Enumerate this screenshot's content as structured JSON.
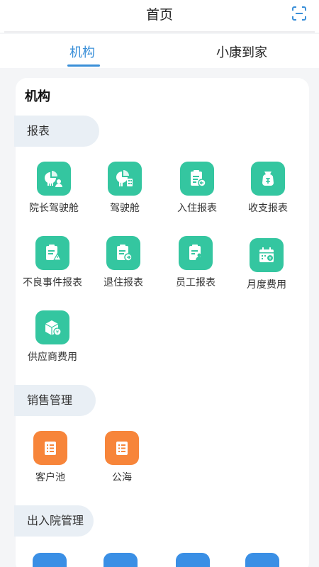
{
  "header": {
    "title": "首页",
    "scan_icon": "scan-icon"
  },
  "tabs": [
    {
      "label": "机构",
      "active": true
    },
    {
      "label": "小康到家",
      "active": false
    }
  ],
  "card": {
    "title": "机构"
  },
  "sections": [
    {
      "label": "报表",
      "items": [
        {
          "label": "院长驾驶舱",
          "icon": "dashboard-user-icon"
        },
        {
          "label": "驾驶舱",
          "icon": "dashboard-icon"
        },
        {
          "label": "入住报表",
          "icon": "check-in-report-icon"
        },
        {
          "label": "收支报表",
          "icon": "money-bag-icon"
        },
        {
          "label": "不良事件报表",
          "icon": "incident-report-icon"
        },
        {
          "label": "退住报表",
          "icon": "check-out-report-icon"
        },
        {
          "label": "员工报表",
          "icon": "staff-report-icon"
        },
        {
          "label": "月度费用",
          "icon": "monthly-fee-icon"
        },
        {
          "label": "供应商费用",
          "icon": "supplier-fee-icon"
        }
      ]
    },
    {
      "label": "销售管理",
      "items": [
        {
          "label": "客户池",
          "icon": "customer-pool-icon"
        },
        {
          "label": "公海",
          "icon": "public-pool-icon"
        }
      ]
    },
    {
      "label": "出入院管理",
      "items": []
    }
  ],
  "colors": {
    "accent": "#3a8fd8",
    "green": "#34c6a0",
    "orange": "#f7853a",
    "blue": "#3a8fe5"
  }
}
